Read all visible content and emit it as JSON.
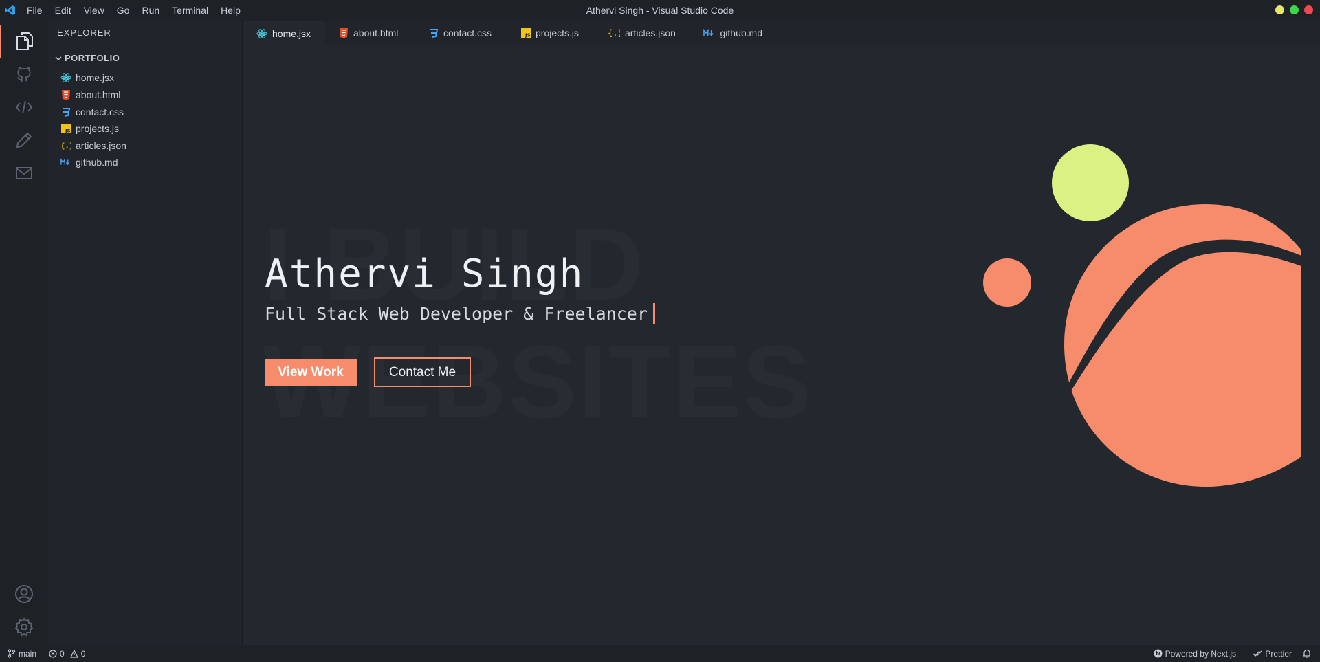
{
  "window": {
    "title": "Athervi Singh - Visual Studio Code",
    "menu": [
      "File",
      "Edit",
      "View",
      "Go",
      "Run",
      "Terminal",
      "Help"
    ],
    "controls": [
      "#e5e66e",
      "#3fd64c",
      "#f0494f"
    ]
  },
  "activity_bar": {
    "items": [
      "files-icon",
      "github-icon",
      "code-icon",
      "pencil-icon",
      "mail-icon"
    ],
    "bottom": [
      "account-icon",
      "settings-icon"
    ]
  },
  "sidebar": {
    "header": "EXPLORER",
    "folder": "PORTFOLIO",
    "files": [
      {
        "name": "home.jsx",
        "icon": "react-icon"
      },
      {
        "name": "about.html",
        "icon": "html-icon"
      },
      {
        "name": "contact.css",
        "icon": "css-icon"
      },
      {
        "name": "projects.js",
        "icon": "js-icon"
      },
      {
        "name": "articles.json",
        "icon": "json-icon"
      },
      {
        "name": "github.md",
        "icon": "markdown-icon"
      }
    ]
  },
  "tabs": [
    {
      "label": "home.jsx",
      "active": true
    },
    {
      "label": "about.html"
    },
    {
      "label": "contact.css"
    },
    {
      "label": "projects.js"
    },
    {
      "label": "articles.json"
    },
    {
      "label": "github.md"
    }
  ],
  "hero": {
    "watermark_1": "I BUILD",
    "watermark_2": "WEBSITES",
    "name": "Athervi Singh",
    "subtitle": "Full Stack Web Developer & Freelancer",
    "primary_button": "View Work",
    "secondary_button": "Contact Me"
  },
  "status": {
    "branch": "main",
    "errors": "0",
    "warnings": "0",
    "powered_by": "Powered by Next.js",
    "formatter": "Prettier"
  },
  "colors": {
    "accent": "#f78c6c",
    "lime": "#d9f283"
  }
}
